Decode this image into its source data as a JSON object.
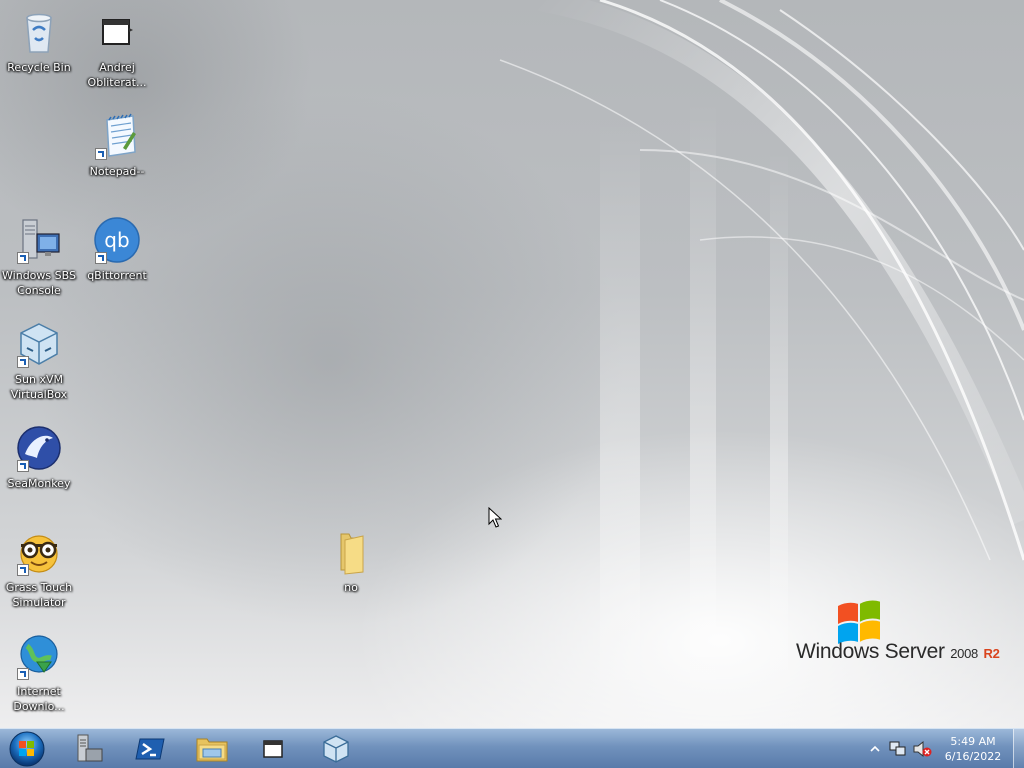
{
  "desktop": {
    "icons": [
      {
        "label": "Recycle Bin",
        "icon": "recycle-bin-icon"
      },
      {
        "label": "Andrej Obliterat...",
        "icon": "app-window-icon"
      },
      {
        "label": "Notepad--",
        "icon": "notepad-icon"
      },
      {
        "label": "Windows SBS Console",
        "icon": "server-console-icon"
      },
      {
        "label": "qBittorrent",
        "icon": "qbittorrent-icon"
      },
      {
        "label": "Sun xVM VirtualBox",
        "icon": "virtualbox-icon"
      },
      {
        "label": "SeaMonkey",
        "icon": "seamonkey-icon"
      },
      {
        "label": "Grass Touch Simulator",
        "icon": "nerd-face-icon"
      },
      {
        "label": "Internet Downlo...",
        "icon": "internet-download-manager-icon"
      },
      {
        "label": "no",
        "icon": "folder-icon"
      }
    ]
  },
  "branding": {
    "name": "Windows Server",
    "version": "2008",
    "edition": "R2"
  },
  "taskbar": {
    "start_icon": "windows-start-orb-icon",
    "pinned": [
      {
        "icon": "server-manager-icon"
      },
      {
        "icon": "powershell-icon"
      },
      {
        "icon": "file-explorer-icon"
      },
      {
        "icon": "app-window-icon"
      },
      {
        "icon": "virtualbox-icon"
      }
    ],
    "tray": {
      "icons": [
        "show-hidden-icons-chevron-icon",
        "network-icon",
        "volume-muted-icon"
      ],
      "time": "5:49 AM",
      "date": "6/16/2022"
    }
  },
  "colors": {
    "taskbar": "#7391bd",
    "windows_red": "#f25022",
    "windows_green": "#7fba00",
    "windows_blue": "#00a4ef",
    "windows_yellow": "#ffb900"
  }
}
